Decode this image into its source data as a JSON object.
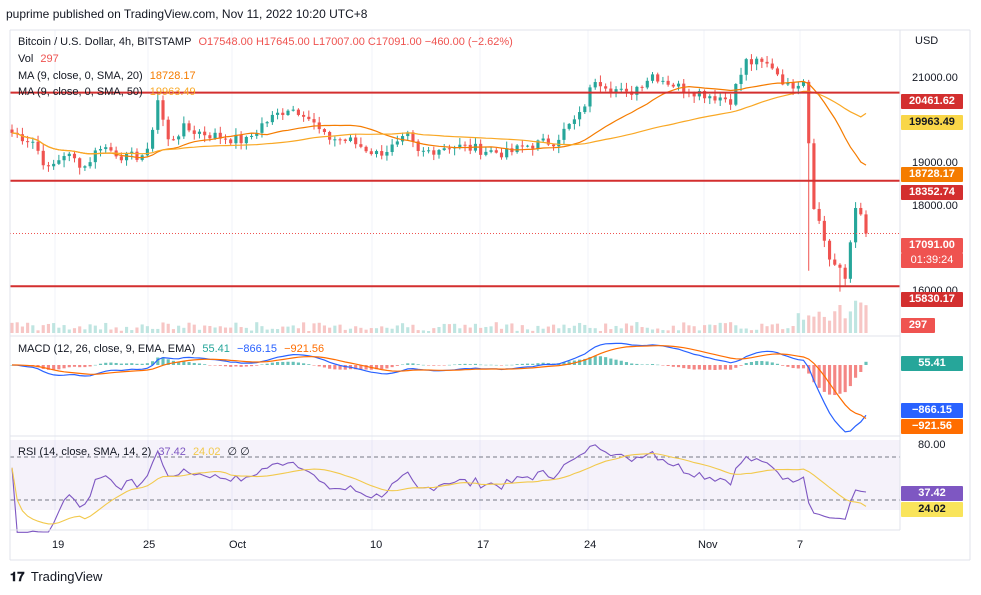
{
  "header": {
    "published": "puprime published on TradingView.com, Nov 11, 2022 10:20 UTC+8"
  },
  "legend": {
    "symbol": "Bitcoin / U.S. Dollar, 4h, BITSTAMP",
    "ohlc": "O17548.00 H17645.00 L17007.00 C17091.00 −460.00 (−2.62%)",
    "vol_label": "Vol",
    "vol_value": "297",
    "ma20_label": "MA (9, close, 0, SMA, 20)",
    "ma20_value": "18728.17",
    "ma50_label": "MA (9, close, 0, SMA, 50)",
    "ma50_value": "19963.49",
    "macd_label": "MACD (12, 26, close, 9, EMA, EMA)",
    "macd_hist": "55.41",
    "macd_line": "−866.15",
    "macd_signal": "−921.56",
    "rsi_label": "RSI (14, close, SMA, 14, 2)",
    "rsi_value": "37.42",
    "rsi_ma": "24.02",
    "rsi_extra": "∅ ∅"
  },
  "price_axis": {
    "currency": "USD",
    "ticks": [
      "21000.00",
      "19000.00",
      "18000.00",
      "16000.00"
    ],
    "labels": {
      "res1": "20461.62",
      "ma50": "19963.49",
      "ma20": "18728.17",
      "res2": "18352.74",
      "last": "17091.00",
      "countdown": "01:39:24",
      "support": "15830.17",
      "volume": "297"
    }
  },
  "macd_axis": {
    "hist": "55.41",
    "macd": "−866.15",
    "signal": "−921.56"
  },
  "rsi_axis": {
    "top": "80.00",
    "value": "37.42",
    "ma": "24.02"
  },
  "time_axis": [
    "19",
    "25",
    "Oct",
    "10",
    "17",
    "24",
    "Nov",
    "7"
  ],
  "footer": {
    "brand": "TradingView"
  },
  "colors": {
    "up": "#26a69a",
    "down": "#ef5350",
    "ma20": "#f57c00",
    "ma50": "#f9a825",
    "macd": "#2962ff",
    "signal": "#ff6d00",
    "rsi": "#7e57c2",
    "hline": "#d32f2f"
  },
  "chart_data": {
    "type": "candlestick",
    "symbol": "BTC/USD",
    "interval": "4h",
    "last": {
      "open": 17548.0,
      "high": 17645.0,
      "low": 17007.0,
      "close": 17091.0,
      "change": -460.0,
      "change_pct": -2.62
    },
    "horizontal_levels": [
      20461.62,
      18352.74,
      15830.17
    ],
    "ma20_last": 18728.17,
    "ma50_last": 19963.49,
    "macd_last": {
      "hist": 55.41,
      "macd": -866.15,
      "signal": -921.56
    },
    "rsi_last": {
      "rsi": 37.42,
      "ma": 24.02
    },
    "price_range": [
      15500,
      21600
    ],
    "anchors": [
      [
        0,
        19500
      ],
      [
        4,
        19300
      ],
      [
        7,
        18600
      ],
      [
        10,
        19000
      ],
      [
        14,
        18700
      ],
      [
        17,
        19200
      ],
      [
        22,
        18900
      ],
      [
        26,
        19000
      ],
      [
        28,
        20300
      ],
      [
        30,
        19300
      ],
      [
        33,
        19600
      ],
      [
        40,
        19400
      ],
      [
        45,
        19300
      ],
      [
        48,
        19700
      ],
      [
        53,
        20100
      ],
      [
        56,
        20000
      ],
      [
        60,
        19400
      ],
      [
        65,
        19300
      ],
      [
        70,
        19000
      ],
      [
        74,
        19200
      ],
      [
        76,
        19400
      ],
      [
        78,
        19000
      ],
      [
        84,
        19200
      ],
      [
        90,
        19100
      ],
      [
        95,
        19000
      ],
      [
        99,
        19200
      ],
      [
        104,
        19300
      ],
      [
        109,
        19900
      ],
      [
        112,
        20800
      ],
      [
        118,
        20400
      ],
      [
        123,
        20900
      ],
      [
        128,
        20600
      ],
      [
        134,
        20400
      ],
      [
        138,
        20300
      ],
      [
        141,
        21200
      ],
      [
        146,
        21100
      ],
      [
        149,
        20600
      ],
      [
        152,
        20800
      ],
      [
        154,
        17800
      ],
      [
        157,
        16500
      ],
      [
        160,
        16000
      ],
      [
        162,
        17800
      ],
      [
        164,
        17091
      ]
    ]
  }
}
